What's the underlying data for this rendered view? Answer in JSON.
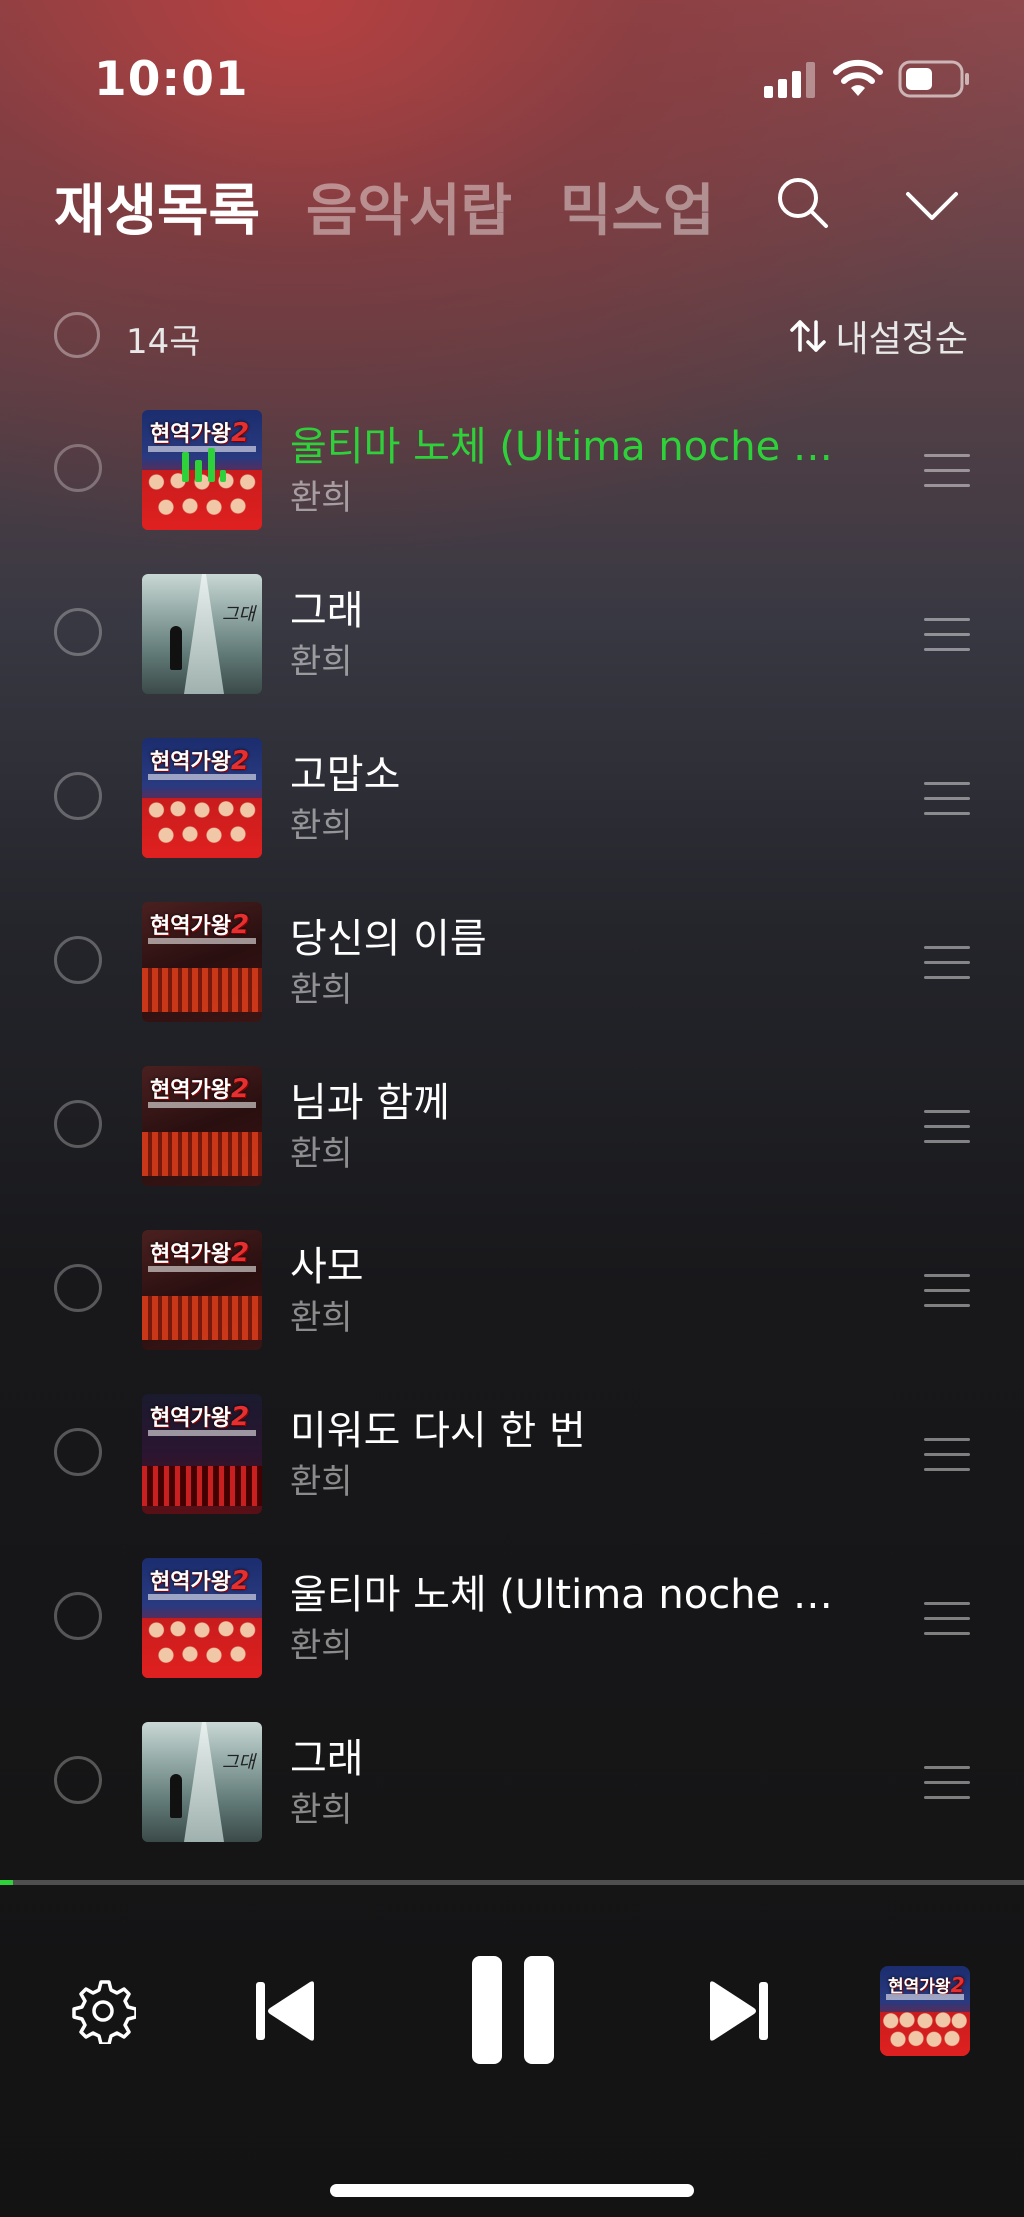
{
  "status_bar": {
    "time": "10:01"
  },
  "header": {
    "tabs": [
      {
        "label": "재생목록",
        "active": true
      },
      {
        "label": "음악서랍",
        "active": false
      },
      {
        "label": "믹스업",
        "active": false
      }
    ],
    "icons": [
      "search-icon",
      "chevron-down-icon"
    ]
  },
  "toolbar": {
    "count": "14곡",
    "sort_label": "내설정순"
  },
  "tracks": [
    {
      "title": "울티마 노체 (Ultima noche 마…",
      "artist": "환희",
      "playing": true,
      "cover": "현역가왕2"
    },
    {
      "title": "그래",
      "artist": "환희",
      "playing": false,
      "cover": "road"
    },
    {
      "title": "고맙소",
      "artist": "환희",
      "playing": false,
      "cover": "현역가왕2"
    },
    {
      "title": "당신의 이름",
      "artist": "환희",
      "playing": false,
      "cover": "현역가왕2"
    },
    {
      "title": "님과 함께",
      "artist": "환희",
      "playing": false,
      "cover": "현역가왕2"
    },
    {
      "title": "사모",
      "artist": "환희",
      "playing": false,
      "cover": "현역가왕2"
    },
    {
      "title": "미워도 다시 한 번",
      "artist": "환희",
      "playing": false,
      "cover": "현역가왕2"
    },
    {
      "title": "울티마 노체 (Ultima noche 마…",
      "artist": "환희",
      "playing": false,
      "cover": "현역가왕2"
    },
    {
      "title": "그래",
      "artist": "환희",
      "playing": false,
      "cover": "road"
    }
  ],
  "player": {
    "progress_fraction": 0.013,
    "controls": [
      "settings-icon",
      "previous-icon",
      "pause-icon",
      "next-icon"
    ],
    "accent": "#2fd13a"
  }
}
